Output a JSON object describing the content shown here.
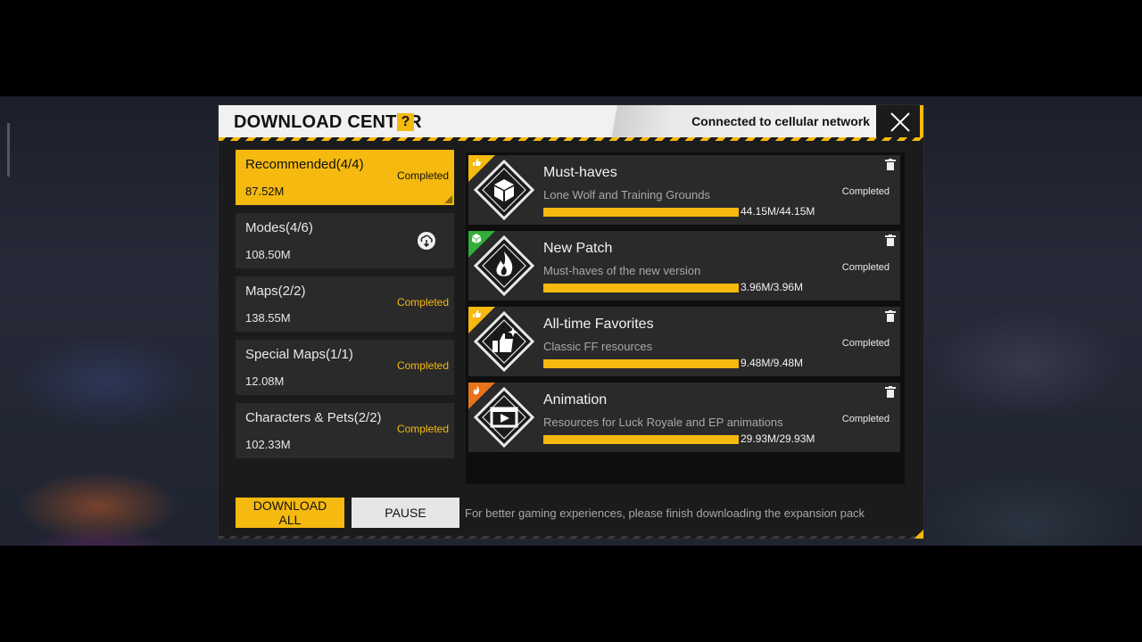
{
  "header": {
    "title": "DOWNLOAD CENTER",
    "help_label": "?",
    "network_status": "Connected to cellular network"
  },
  "categories": [
    {
      "name": "Recommended(4/4)",
      "size": "87.52M",
      "status": "Completed",
      "active": true
    },
    {
      "name": "Modes(4/6)",
      "size": "108.50M",
      "status": "",
      "active": false
    },
    {
      "name": "Maps(2/2)",
      "size": "138.55M",
      "status": "Completed",
      "active": false
    },
    {
      "name": "Special Maps(1/1)",
      "size": "12.08M",
      "status": "Completed",
      "active": false
    },
    {
      "name": "Characters & Pets(2/2)",
      "size": "102.33M",
      "status": "Completed",
      "active": false
    }
  ],
  "resources": [
    {
      "name": "Must-haves",
      "desc": "Lone Wolf and Training Grounds",
      "size": "44.15M/44.15M",
      "status": "Completed",
      "progress": 1.0,
      "icon": "cube-icon",
      "tag_icon": "thumbs-up-icon",
      "tag_color": "#f5b90f"
    },
    {
      "name": "New Patch",
      "desc": "Must-haves of the new version",
      "size": "3.96M/3.96M",
      "status": "Completed",
      "progress": 1.0,
      "icon": "flame-icon",
      "tag_icon": "box-icon",
      "tag_color": "#2fae3a"
    },
    {
      "name": "All-time Favorites",
      "desc": "Classic FF resources",
      "size": "9.48M/9.48M",
      "status": "Completed",
      "progress": 1.0,
      "icon": "thumbs-up-sparkle-icon",
      "tag_icon": "thumbs-up-icon",
      "tag_color": "#f5b90f"
    },
    {
      "name": "Animation",
      "desc": "Resources for Luck Royale and EP animations",
      "size": "29.93M/29.93M",
      "status": "Completed",
      "progress": 1.0,
      "icon": "play-icon",
      "tag_icon": "flame-icon",
      "tag_color": "#e8731a"
    }
  ],
  "footer": {
    "download_all_label": "DOWNLOAD ALL",
    "pause_label": "PAUSE",
    "hint": "For better gaming experiences, please finish downloading the expansion pack"
  },
  "colors": {
    "accent": "#f5b90f",
    "panel": "#1b1b1c",
    "card": "#2a2a2b"
  }
}
